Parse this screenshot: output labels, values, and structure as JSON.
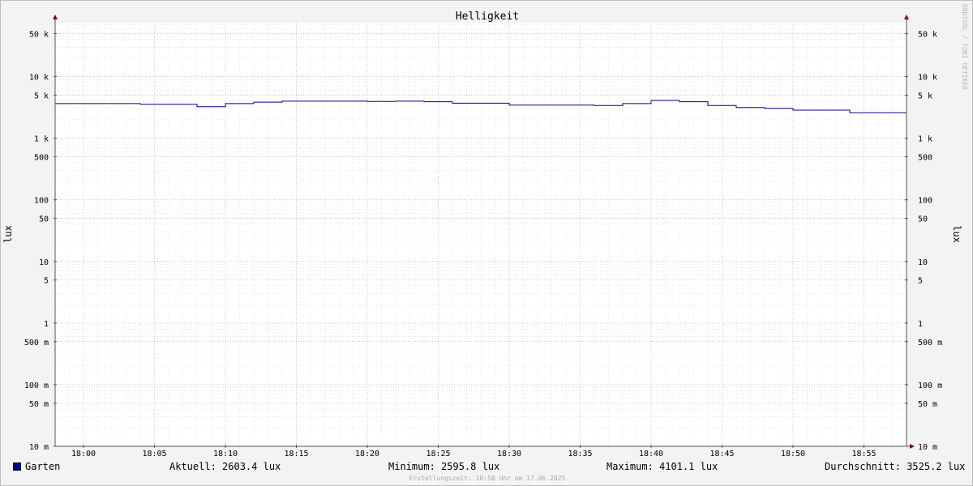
{
  "chart_data": {
    "type": "line",
    "title": "Helligkeit",
    "ylabel": "lux",
    "yscale": "log",
    "ylim": [
      0.01,
      75000
    ],
    "xlim": [
      "17:58",
      "18:58"
    ],
    "x_ticks": [
      "18:00",
      "18:05",
      "18:10",
      "18:15",
      "18:20",
      "18:25",
      "18:30",
      "18:35",
      "18:40",
      "18:45",
      "18:50",
      "18:55"
    ],
    "y_ticks": [
      {
        "value": 50000,
        "label": "50 k"
      },
      {
        "value": 10000,
        "label": "10 k"
      },
      {
        "value": 5000,
        "label": "5 k"
      },
      {
        "value": 1000,
        "label": "1 k"
      },
      {
        "value": 500,
        "label": "500"
      },
      {
        "value": 100,
        "label": "100"
      },
      {
        "value": 50,
        "label": "50"
      },
      {
        "value": 10,
        "label": "10"
      },
      {
        "value": 5,
        "label": "5"
      },
      {
        "value": 1,
        "label": "1"
      },
      {
        "value": 0.5,
        "label": "500 m"
      },
      {
        "value": 0.1,
        "label": "100 m"
      },
      {
        "value": 0.05,
        "label": "50 m"
      },
      {
        "value": 0.01,
        "label": "10 m"
      }
    ],
    "grid": true,
    "series": [
      {
        "name": "Garten",
        "color": "#00008b",
        "points": [
          {
            "x": "17:58",
            "y": 3650
          },
          {
            "x": "18:04",
            "y": 3550
          },
          {
            "x": "18:08",
            "y": 3250
          },
          {
            "x": "18:10",
            "y": 3650
          },
          {
            "x": "18:12",
            "y": 3850
          },
          {
            "x": "18:14",
            "y": 4000
          },
          {
            "x": "18:20",
            "y": 3950
          },
          {
            "x": "18:22",
            "y": 4000
          },
          {
            "x": "18:24",
            "y": 3900
          },
          {
            "x": "18:26",
            "y": 3700
          },
          {
            "x": "18:30",
            "y": 3450
          },
          {
            "x": "18:36",
            "y": 3400
          },
          {
            "x": "18:38",
            "y": 3650
          },
          {
            "x": "18:40",
            "y": 4100
          },
          {
            "x": "18:42",
            "y": 3900
          },
          {
            "x": "18:44",
            "y": 3400
          },
          {
            "x": "18:46",
            "y": 3150
          },
          {
            "x": "18:48",
            "y": 3050
          },
          {
            "x": "18:50",
            "y": 2850
          },
          {
            "x": "18:54",
            "y": 2600
          },
          {
            "x": "18:58",
            "y": 2600
          }
        ]
      }
    ]
  },
  "legend": {
    "series_name": "Garten",
    "swatch_color": "#000099",
    "current": "Aktuell: 2603.4 lux",
    "minimum": "Minimum: 2595.8 lux",
    "maximum": "Maximum: 4101.1 lux",
    "average": "Durchschnitt: 3525.2 lux"
  },
  "footnote": "Erstellungszeit: 18:58 Uhr am 17.06.2025",
  "watermark": "RRDTOOL / TOBI OETIKER"
}
